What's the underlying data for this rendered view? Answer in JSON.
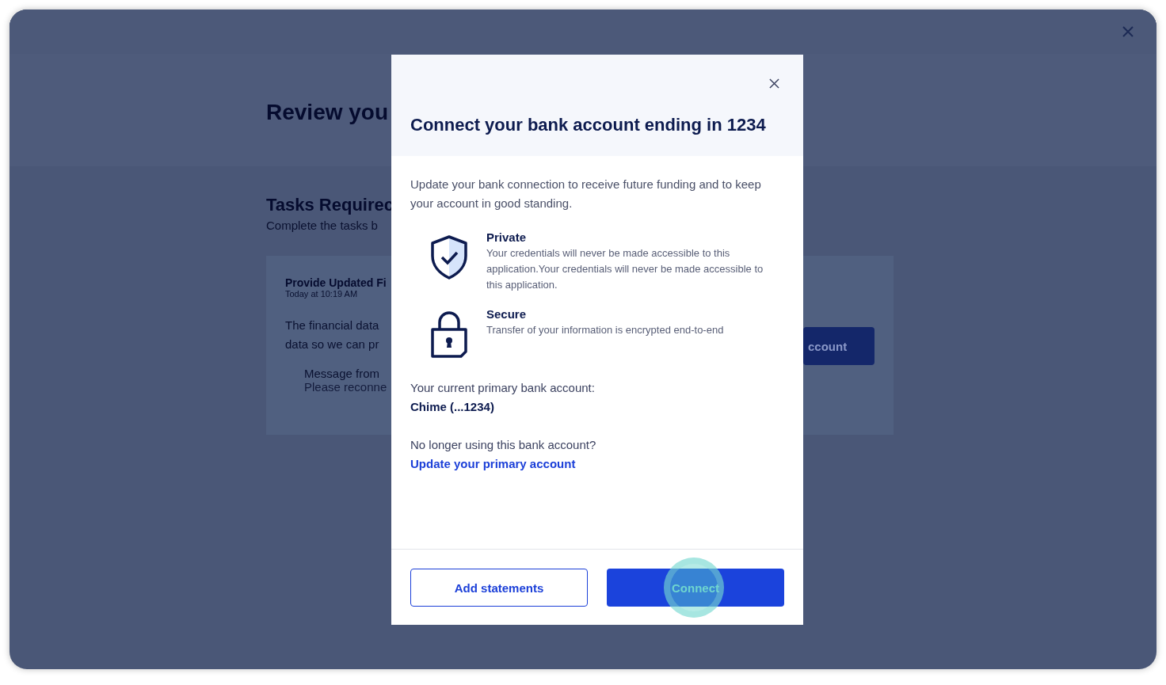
{
  "background_page": {
    "title": "Review you",
    "section_title": "Tasks Requirec",
    "section_subtitle": "Complete the tasks b",
    "task": {
      "title": "Provide Updated Fi",
      "time": "Today at 10:19 AM",
      "body_lines": [
        "The financial data",
        "data so we can pr"
      ],
      "message_label": "Message from",
      "message_text": "Please reconne",
      "button": "ccount"
    }
  },
  "dialog": {
    "title": "Connect your bank account ending in 1234",
    "intro": "Update your bank connection to receive future funding and to keep your account in good standing.",
    "features": [
      {
        "kind": "shield",
        "title": "Private",
        "text": "Your credentials will never be made accessible to this application.Your credentials will never be made accessible to this application."
      },
      {
        "kind": "lock",
        "title": "Secure",
        "text": "Transfer of your information is encrypted end-to-end"
      }
    ],
    "primary_label": "Your current primary bank account:",
    "primary_account": "Chime (...1234)",
    "switch_prompt": "No longer using this bank account?",
    "switch_link": "Update your primary account",
    "buttons": [
      {
        "kind": "secondary",
        "label": "Add statements"
      },
      {
        "kind": "primary",
        "label": "Connect",
        "clicked": true
      }
    ]
  }
}
